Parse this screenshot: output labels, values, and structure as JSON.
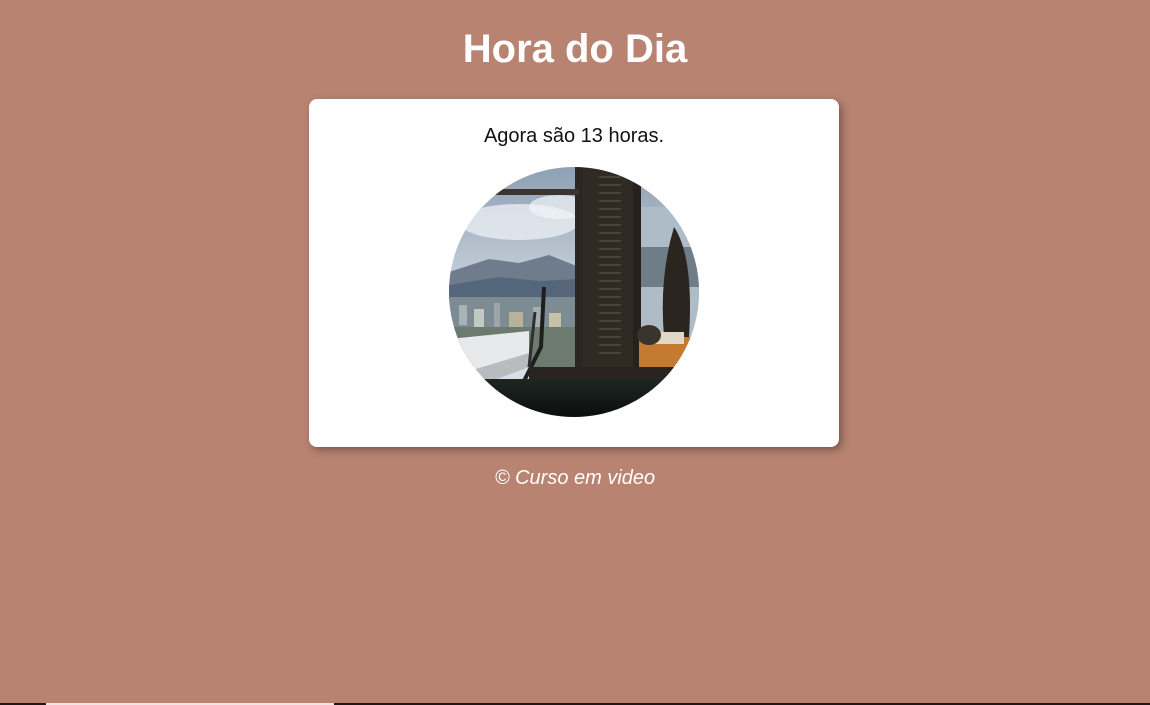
{
  "page": {
    "title": "Hora do Dia",
    "message": "Agora são 13 horas.",
    "footer": "© Curso em video"
  },
  "image": {
    "subject": "window-view-photo",
    "shape": "circle"
  },
  "colors": {
    "background": "#b88371",
    "card": "#ffffff",
    "title": "#ffffff",
    "message": "#111111",
    "footer": "#ffffff"
  }
}
